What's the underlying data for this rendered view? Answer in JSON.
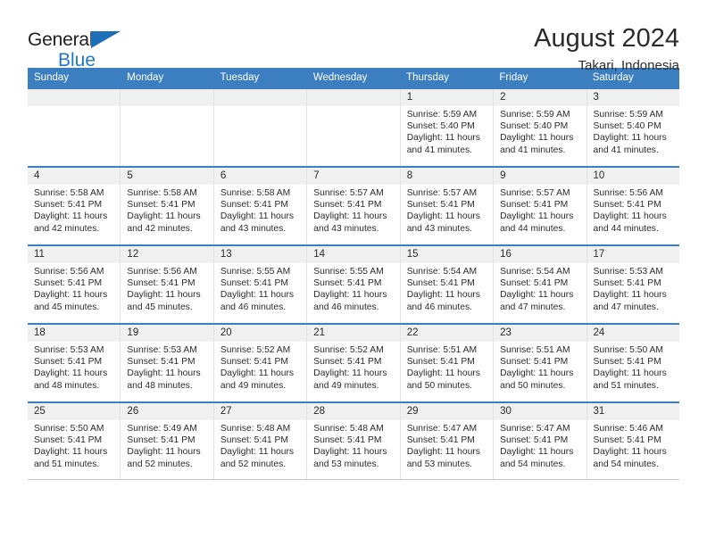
{
  "brand": {
    "line1": "General",
    "line2": "Blue",
    "triangle_icon": "blue-triangle-logo-mark"
  },
  "header": {
    "title": "August 2024",
    "subtitle": "Takari, Indonesia"
  },
  "colors": {
    "header_blue": "#3c7fc1",
    "brand_blue": "#1f78c8",
    "cell_head_gray": "#f0f0f0",
    "text": "#2b2b2b"
  },
  "calendar": {
    "day_headers": [
      "Sunday",
      "Monday",
      "Tuesday",
      "Wednesday",
      "Thursday",
      "Friday",
      "Saturday"
    ],
    "weeks": [
      [
        {
          "day": "",
          "lines": []
        },
        {
          "day": "",
          "lines": []
        },
        {
          "day": "",
          "lines": []
        },
        {
          "day": "",
          "lines": []
        },
        {
          "day": "1",
          "lines": [
            "Sunrise: 5:59 AM",
            "Sunset: 5:40 PM",
            "Daylight: 11 hours",
            "and 41 minutes."
          ]
        },
        {
          "day": "2",
          "lines": [
            "Sunrise: 5:59 AM",
            "Sunset: 5:40 PM",
            "Daylight: 11 hours",
            "and 41 minutes."
          ]
        },
        {
          "day": "3",
          "lines": [
            "Sunrise: 5:59 AM",
            "Sunset: 5:40 PM",
            "Daylight: 11 hours",
            "and 41 minutes."
          ]
        }
      ],
      [
        {
          "day": "4",
          "lines": [
            "Sunrise: 5:58 AM",
            "Sunset: 5:41 PM",
            "Daylight: 11 hours",
            "and 42 minutes."
          ]
        },
        {
          "day": "5",
          "lines": [
            "Sunrise: 5:58 AM",
            "Sunset: 5:41 PM",
            "Daylight: 11 hours",
            "and 42 minutes."
          ]
        },
        {
          "day": "6",
          "lines": [
            "Sunrise: 5:58 AM",
            "Sunset: 5:41 PM",
            "Daylight: 11 hours",
            "and 43 minutes."
          ]
        },
        {
          "day": "7",
          "lines": [
            "Sunrise: 5:57 AM",
            "Sunset: 5:41 PM",
            "Daylight: 11 hours",
            "and 43 minutes."
          ]
        },
        {
          "day": "8",
          "lines": [
            "Sunrise: 5:57 AM",
            "Sunset: 5:41 PM",
            "Daylight: 11 hours",
            "and 43 minutes."
          ]
        },
        {
          "day": "9",
          "lines": [
            "Sunrise: 5:57 AM",
            "Sunset: 5:41 PM",
            "Daylight: 11 hours",
            "and 44 minutes."
          ]
        },
        {
          "day": "10",
          "lines": [
            "Sunrise: 5:56 AM",
            "Sunset: 5:41 PM",
            "Daylight: 11 hours",
            "and 44 minutes."
          ]
        }
      ],
      [
        {
          "day": "11",
          "lines": [
            "Sunrise: 5:56 AM",
            "Sunset: 5:41 PM",
            "Daylight: 11 hours",
            "and 45 minutes."
          ]
        },
        {
          "day": "12",
          "lines": [
            "Sunrise: 5:56 AM",
            "Sunset: 5:41 PM",
            "Daylight: 11 hours",
            "and 45 minutes."
          ]
        },
        {
          "day": "13",
          "lines": [
            "Sunrise: 5:55 AM",
            "Sunset: 5:41 PM",
            "Daylight: 11 hours",
            "and 46 minutes."
          ]
        },
        {
          "day": "14",
          "lines": [
            "Sunrise: 5:55 AM",
            "Sunset: 5:41 PM",
            "Daylight: 11 hours",
            "and 46 minutes."
          ]
        },
        {
          "day": "15",
          "lines": [
            "Sunrise: 5:54 AM",
            "Sunset: 5:41 PM",
            "Daylight: 11 hours",
            "and 46 minutes."
          ]
        },
        {
          "day": "16",
          "lines": [
            "Sunrise: 5:54 AM",
            "Sunset: 5:41 PM",
            "Daylight: 11 hours",
            "and 47 minutes."
          ]
        },
        {
          "day": "17",
          "lines": [
            "Sunrise: 5:53 AM",
            "Sunset: 5:41 PM",
            "Daylight: 11 hours",
            "and 47 minutes."
          ]
        }
      ],
      [
        {
          "day": "18",
          "lines": [
            "Sunrise: 5:53 AM",
            "Sunset: 5:41 PM",
            "Daylight: 11 hours",
            "and 48 minutes."
          ]
        },
        {
          "day": "19",
          "lines": [
            "Sunrise: 5:53 AM",
            "Sunset: 5:41 PM",
            "Daylight: 11 hours",
            "and 48 minutes."
          ]
        },
        {
          "day": "20",
          "lines": [
            "Sunrise: 5:52 AM",
            "Sunset: 5:41 PM",
            "Daylight: 11 hours",
            "and 49 minutes."
          ]
        },
        {
          "day": "21",
          "lines": [
            "Sunrise: 5:52 AM",
            "Sunset: 5:41 PM",
            "Daylight: 11 hours",
            "and 49 minutes."
          ]
        },
        {
          "day": "22",
          "lines": [
            "Sunrise: 5:51 AM",
            "Sunset: 5:41 PM",
            "Daylight: 11 hours",
            "and 50 minutes."
          ]
        },
        {
          "day": "23",
          "lines": [
            "Sunrise: 5:51 AM",
            "Sunset: 5:41 PM",
            "Daylight: 11 hours",
            "and 50 minutes."
          ]
        },
        {
          "day": "24",
          "lines": [
            "Sunrise: 5:50 AM",
            "Sunset: 5:41 PM",
            "Daylight: 11 hours",
            "and 51 minutes."
          ]
        }
      ],
      [
        {
          "day": "25",
          "lines": [
            "Sunrise: 5:50 AM",
            "Sunset: 5:41 PM",
            "Daylight: 11 hours",
            "and 51 minutes."
          ]
        },
        {
          "day": "26",
          "lines": [
            "Sunrise: 5:49 AM",
            "Sunset: 5:41 PM",
            "Daylight: 11 hours",
            "and 52 minutes."
          ]
        },
        {
          "day": "27",
          "lines": [
            "Sunrise: 5:48 AM",
            "Sunset: 5:41 PM",
            "Daylight: 11 hours",
            "and 52 minutes."
          ]
        },
        {
          "day": "28",
          "lines": [
            "Sunrise: 5:48 AM",
            "Sunset: 5:41 PM",
            "Daylight: 11 hours",
            "and 53 minutes."
          ]
        },
        {
          "day": "29",
          "lines": [
            "Sunrise: 5:47 AM",
            "Sunset: 5:41 PM",
            "Daylight: 11 hours",
            "and 53 minutes."
          ]
        },
        {
          "day": "30",
          "lines": [
            "Sunrise: 5:47 AM",
            "Sunset: 5:41 PM",
            "Daylight: 11 hours",
            "and 54 minutes."
          ]
        },
        {
          "day": "31",
          "lines": [
            "Sunrise: 5:46 AM",
            "Sunset: 5:41 PM",
            "Daylight: 11 hours",
            "and 54 minutes."
          ]
        }
      ]
    ]
  }
}
